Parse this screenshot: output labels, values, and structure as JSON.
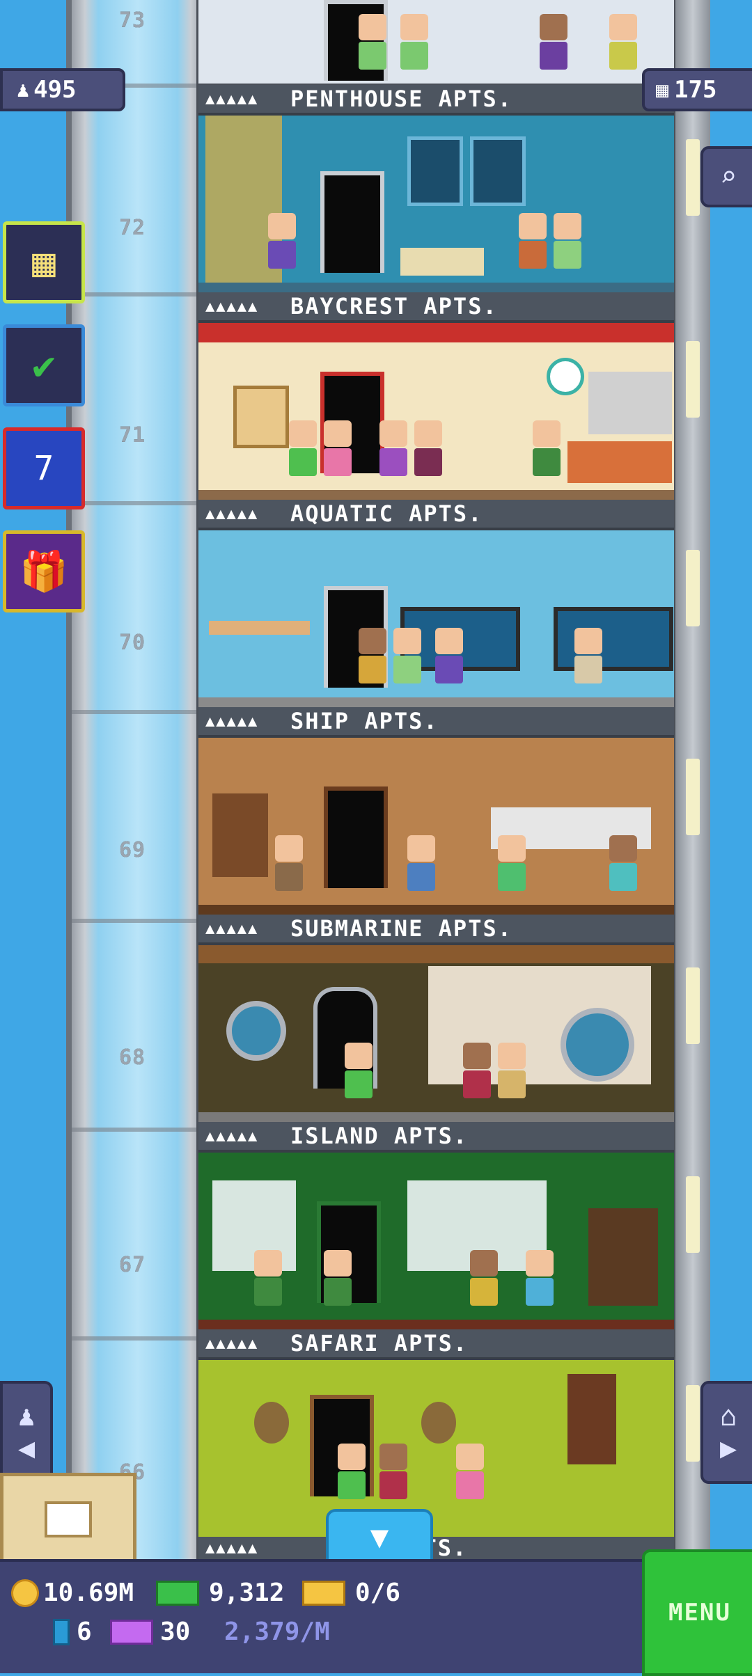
{
  "hud": {
    "population": "495",
    "floors_count": "175"
  },
  "shaft_floor_numbers": [
    "73",
    "72",
    "71",
    "70",
    "69",
    "68",
    "67",
    "66"
  ],
  "floors": [
    {
      "label": "PENTHOUSE APTS.",
      "stars": "▲▲▲▲▲"
    },
    {
      "label": "BAYCREST APTS.",
      "stars": "▲▲▲▲▲"
    },
    {
      "label": "AQUATIC APTS.",
      "stars": "▲▲▲▲▲"
    },
    {
      "label": "SHIP APTS.",
      "stars": "▲▲▲▲▲"
    },
    {
      "label": "SUBMARINE APTS.",
      "stars": "▲▲▲▲▲"
    },
    {
      "label": "ISLAND APTS.",
      "stars": "▲▲▲▲▲"
    },
    {
      "label": "SAFARI APTS.",
      "stars": "▲▲▲▲▲"
    },
    {
      "label": "APTS.",
      "stars": "▲▲▲▲▲"
    }
  ],
  "side_buttons": [
    {
      "name": "build-floor-button",
      "icon": "building-icon"
    },
    {
      "name": "missions-button",
      "icon": "checklist-icon"
    },
    {
      "name": "calendar-button",
      "icon": "calendar-icon",
      "text": "7"
    },
    {
      "name": "gift-button",
      "icon": "gift-icon"
    }
  ],
  "bottom_bar": {
    "coins": "10.69M",
    "bux": "9,312",
    "tickets": "0/6",
    "golden_tickets": "6",
    "vip": "30",
    "rate": "2,379/M",
    "menu_label": "MENU"
  },
  "colors": {
    "sky": "#3fa7e6",
    "menu_green": "#2fc23a",
    "hud_purple": "#4b4f7a"
  }
}
